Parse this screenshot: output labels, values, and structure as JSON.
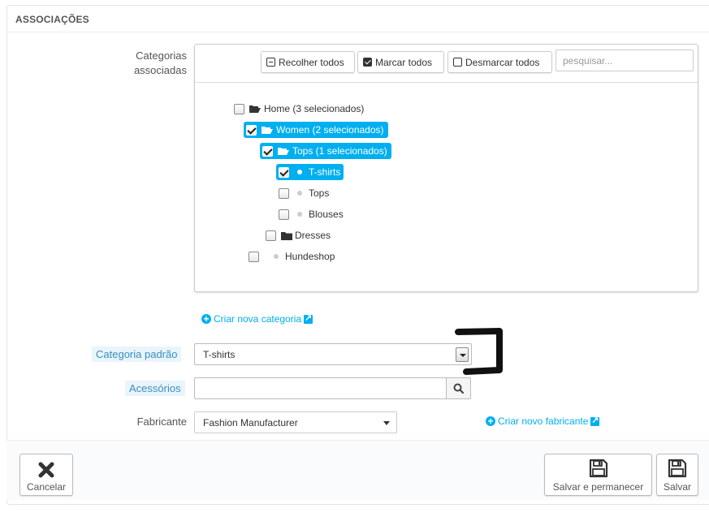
{
  "panel": {
    "title": "ASSOCIAÇÕES"
  },
  "categories": {
    "label_line1": "Categorias",
    "label_line2": "associadas",
    "toolbar": {
      "collapse_label": "Recolher todos",
      "check_all_label": "Marcar todos",
      "uncheck_all_label": "Desmarcar todos",
      "search_placeholder": "pesquisar..."
    },
    "tree": [
      {
        "label": "Home (3 selecionados)",
        "checked": false,
        "selected": false,
        "icon": "folder-open-icon"
      },
      {
        "label": "Women (2 selecionados)",
        "checked": true,
        "selected": true,
        "icon": "folder-open-icon"
      },
      {
        "label": "Tops (1 selecionados)",
        "checked": true,
        "selected": true,
        "icon": "folder-open-icon"
      },
      {
        "label": "T-shirts",
        "checked": true,
        "selected": true,
        "icon": "bullet-icon"
      },
      {
        "label": "Tops",
        "checked": false,
        "selected": false,
        "icon": "bullet-icon"
      },
      {
        "label": "Blouses",
        "checked": false,
        "selected": false,
        "icon": "bullet-icon"
      },
      {
        "label": "Dresses",
        "checked": false,
        "selected": false,
        "icon": "folder-icon"
      },
      {
        "label": "Hundeshop",
        "checked": false,
        "selected": false,
        "icon": "bullet-icon"
      }
    ],
    "create_link": "Criar nova categoria"
  },
  "default_category": {
    "label": "Categoria padrão",
    "value": "T-shirts"
  },
  "accessories": {
    "label": "Acessórios",
    "value": ""
  },
  "manufacturer": {
    "label": "Fabricante",
    "value": "Fashion Manufacturer",
    "create_link": "Criar novo fabricante"
  },
  "footer": {
    "cancel_label": "Cancelar",
    "save_stay_label": "Salvar e permanecer",
    "save_label": "Salvar"
  },
  "colors": {
    "accent": "#00aff0",
    "highlight_bg": "#e9f5fb",
    "annotation": "#111111"
  }
}
